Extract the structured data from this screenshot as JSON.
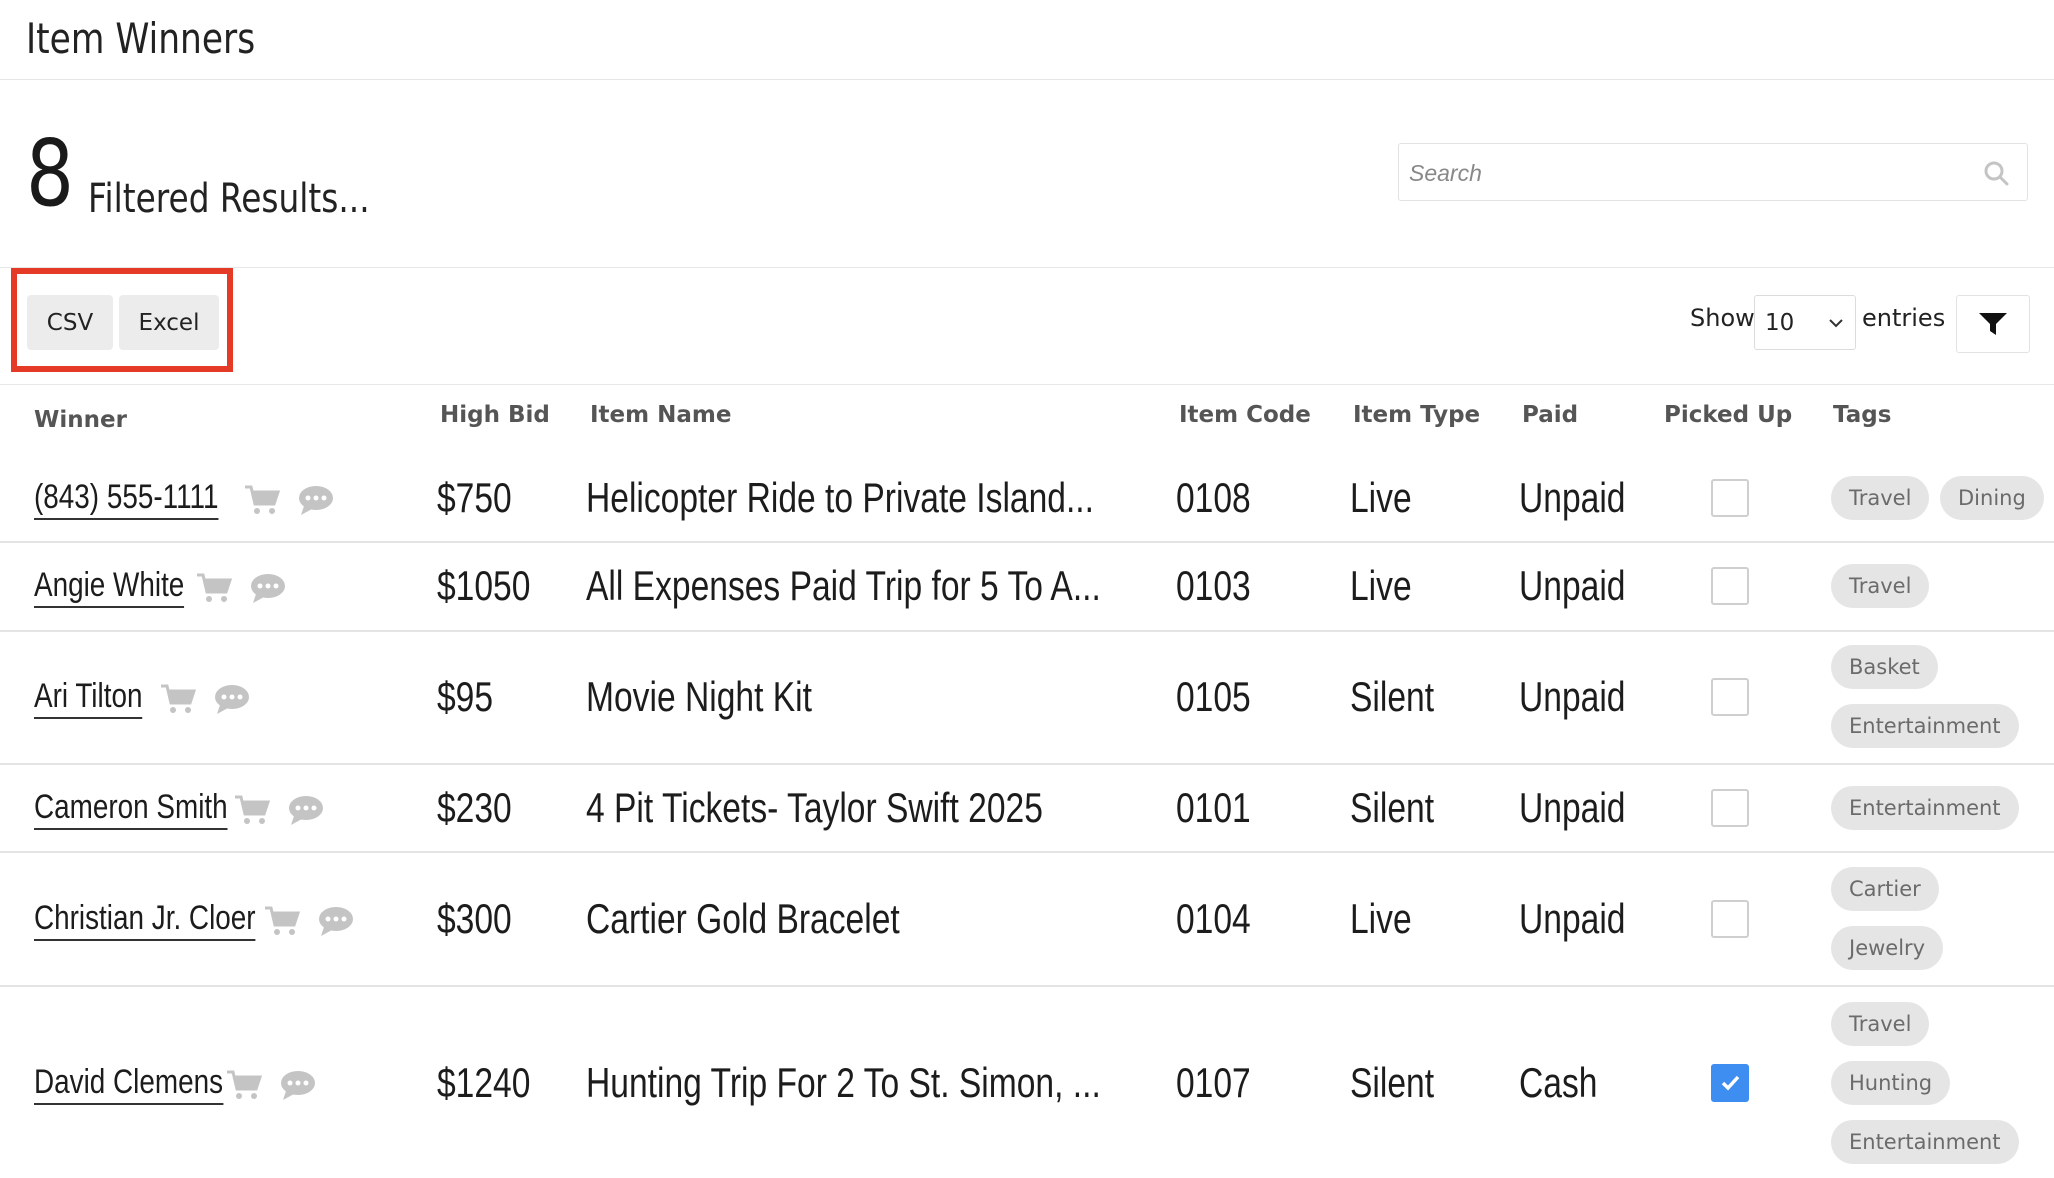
{
  "header": {
    "title": "Item Winners"
  },
  "results": {
    "count": "8",
    "label": "Filtered Results..."
  },
  "search": {
    "placeholder": "Search",
    "value": ""
  },
  "export": {
    "csv_label": "CSV",
    "excel_label": "Excel"
  },
  "entries": {
    "show_label": "Show",
    "value": "10",
    "suffix_label": "entries"
  },
  "table": {
    "columns": [
      "Winner",
      "High Bid",
      "Item Name",
      "Item Code",
      "Item Type",
      "Paid",
      "Picked Up",
      "Tags"
    ],
    "rows": [
      {
        "winner": "(843) 555-1111",
        "bid": "$750",
        "item": "Helicopter Ride to Private Island...",
        "code": "0108",
        "type": "Live",
        "paid": "Unpaid",
        "picked_up": false,
        "tags": [
          "Travel",
          "Dining"
        ]
      },
      {
        "winner": "Angie White",
        "bid": "$1050",
        "item": "All Expenses Paid Trip for 5 To A...",
        "code": "0103",
        "type": "Live",
        "paid": "Unpaid",
        "picked_up": false,
        "tags": [
          "Travel"
        ]
      },
      {
        "winner": "Ari Tilton",
        "bid": "$95",
        "item": "Movie Night Kit",
        "code": "0105",
        "type": "Silent",
        "paid": "Unpaid",
        "picked_up": false,
        "tags": [
          "Basket",
          "Entertainment"
        ]
      },
      {
        "winner": "Cameron Smith",
        "bid": "$230",
        "item": "4 Pit Tickets- Taylor Swift 2025",
        "code": "0101",
        "type": "Silent",
        "paid": "Unpaid",
        "picked_up": false,
        "tags": [
          "Entertainment"
        ]
      },
      {
        "winner": "Christian Jr. Cloer",
        "bid": "$300",
        "item": "Cartier Gold Bracelet",
        "code": "0104",
        "type": "Live",
        "paid": "Unpaid",
        "picked_up": false,
        "tags": [
          "Cartier",
          "Jewelry"
        ]
      },
      {
        "winner": "David Clemens",
        "bid": "$1240",
        "item": "Hunting Trip For 2 To St. Simon, ...",
        "code": "0107",
        "type": "Silent",
        "paid": "Cash",
        "picked_up": true,
        "tags": [
          "Travel",
          "Hunting",
          "Entertainment"
        ]
      }
    ]
  },
  "colors": {
    "accent_highlight": "#e53a25",
    "checkbox_checked": "#3d8ef0",
    "tag_bg": "#e5e5e5",
    "icon_gray": "#c4c4c4"
  },
  "icons": {
    "search": "search-icon",
    "cart": "cart-icon",
    "chat": "chat-bubble-icon",
    "filter": "filter-funnel-icon",
    "chevron": "chevron-down-icon",
    "check": "checkmark-icon"
  }
}
